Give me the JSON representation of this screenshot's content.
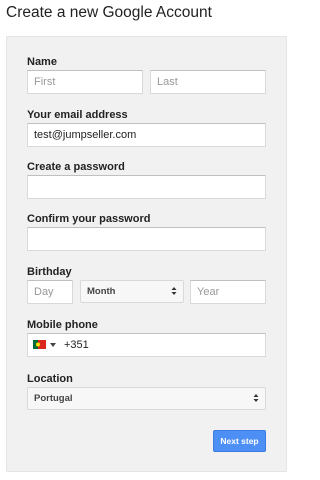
{
  "page": {
    "title": "Create a new Google Account"
  },
  "form": {
    "name": {
      "label": "Name",
      "first_placeholder": "First",
      "last_placeholder": "Last",
      "first_value": "",
      "last_value": ""
    },
    "email": {
      "label": "Your email address",
      "value": "test@jumpseller.com"
    },
    "password": {
      "label": "Create a password",
      "value": ""
    },
    "confirm_password": {
      "label": "Confirm your password",
      "value": ""
    },
    "birthday": {
      "label": "Birthday",
      "day_placeholder": "Day",
      "month_value": "Month",
      "year_placeholder": "Year"
    },
    "mobile_phone": {
      "label": "Mobile phone",
      "country_flag": "portugal-flag-icon",
      "value": "+351"
    },
    "location": {
      "label": "Location",
      "value": "Portugal"
    },
    "next_button_label": "Next step"
  },
  "colors": {
    "panel_background": "#f1f1f1",
    "button_blue": "#4d8ff5",
    "flag_green": "#046a38",
    "flag_red": "#da291c"
  }
}
